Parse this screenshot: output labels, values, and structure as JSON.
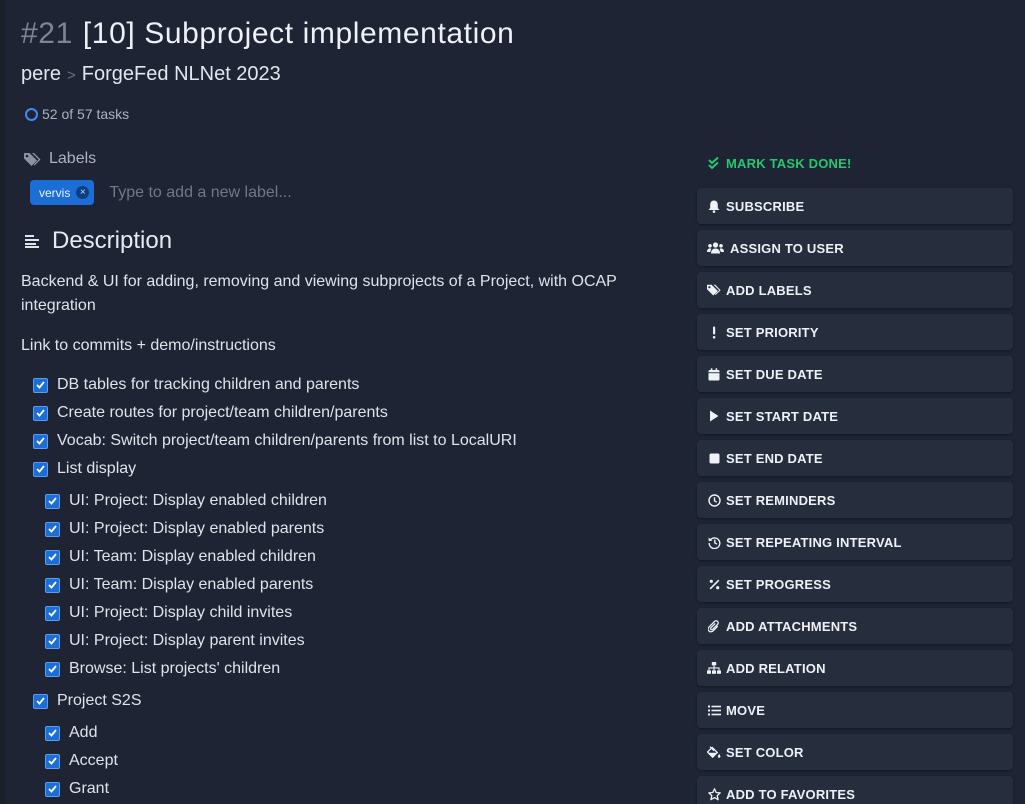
{
  "task": {
    "id": "#21",
    "title": "[10] Subproject implementation",
    "namespace": "pere",
    "breadcrumb_separator": ">",
    "project": "ForgeFed NLNet 2023",
    "progress_text": "52 of 57 tasks"
  },
  "labels": {
    "heading": "Labels",
    "items": [
      {
        "name": "vervis",
        "remove": "×"
      }
    ],
    "input_placeholder": "Type to add a new label..."
  },
  "description": {
    "heading": "Description",
    "paragraphs": [
      "Backend & UI for adding, removing and viewing subprojects of a Project, with OCAP integration",
      "Link to commits + demo/instructions"
    ]
  },
  "checklist": [
    {
      "text": "DB tables for tracking children and parents",
      "checked": true,
      "level": 0
    },
    {
      "text": "Create routes for project/team children/parents",
      "checked": true,
      "level": 0
    },
    {
      "text": "Vocab: Switch project/team children/parents from list to LocalURI",
      "checked": true,
      "level": 0
    },
    {
      "text": "List display",
      "checked": true,
      "level": 0
    },
    {
      "text": "UI: Project: Display enabled children",
      "checked": true,
      "level": 1
    },
    {
      "text": "UI: Project: Display enabled parents",
      "checked": true,
      "level": 1
    },
    {
      "text": "UI: Team: Display enabled children",
      "checked": true,
      "level": 1
    },
    {
      "text": "UI: Team: Display enabled parents",
      "checked": true,
      "level": 1
    },
    {
      "text": "UI: Project: Display child invites",
      "checked": true,
      "level": 1
    },
    {
      "text": "UI: Project: Display parent invites",
      "checked": true,
      "level": 1
    },
    {
      "text": "Browse: List projects' children",
      "checked": true,
      "level": 1
    },
    {
      "text": "Project S2S",
      "checked": true,
      "level": 0
    },
    {
      "text": "Add",
      "checked": true,
      "level": 1
    },
    {
      "text": "Accept",
      "checked": true,
      "level": 1
    },
    {
      "text": "Grant",
      "checked": true,
      "level": 1
    }
  ],
  "actions": {
    "mark_done": {
      "label": "MARK TASK DONE!",
      "icon": "double-check-icon"
    },
    "buttons": [
      {
        "label": "SUBSCRIBE",
        "icon": "bell-icon"
      },
      {
        "label": "ASSIGN TO USER",
        "icon": "users-icon"
      },
      {
        "label": "ADD LABELS",
        "icon": "tags-icon"
      },
      {
        "label": "SET PRIORITY",
        "icon": "exclamation-icon"
      },
      {
        "label": "SET DUE DATE",
        "icon": "calendar-icon"
      },
      {
        "label": "SET START DATE",
        "icon": "play-icon"
      },
      {
        "label": "SET END DATE",
        "icon": "stop-icon"
      },
      {
        "label": "SET REMINDERS",
        "icon": "clock-icon"
      },
      {
        "label": "SET REPEATING INTERVAL",
        "icon": "history-icon"
      },
      {
        "label": "SET PROGRESS",
        "icon": "percent-icon"
      },
      {
        "label": "ADD ATTACHMENTS",
        "icon": "paperclip-icon"
      },
      {
        "label": "ADD RELATION",
        "icon": "sitemap-icon"
      },
      {
        "label": "MOVE",
        "icon": "list-icon"
      },
      {
        "label": "SET COLOR",
        "icon": "paint-bucket-icon"
      },
      {
        "label": "ADD TO FAVORITES",
        "icon": "star-icon"
      }
    ]
  },
  "colors": {
    "background": "#1e2434",
    "accent": "#1c6ed5",
    "success": "#28c76f",
    "button_bg": "#262d3d"
  }
}
